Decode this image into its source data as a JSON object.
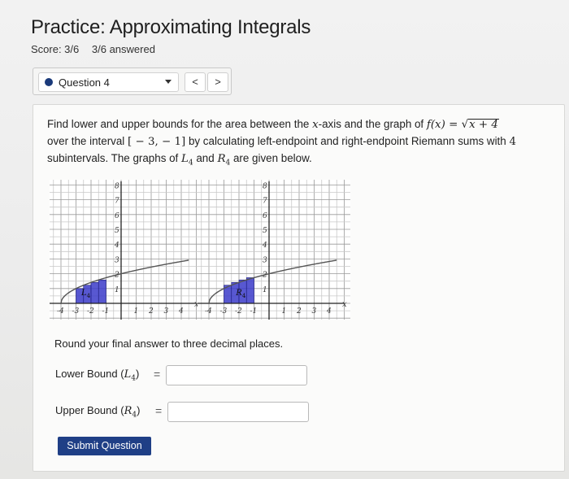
{
  "page": {
    "title": "Practice: Approximating Integrals",
    "score": "Score: 3/6",
    "answered": "3/6 answered"
  },
  "question_nav": {
    "label": "Question 4",
    "prev": "<",
    "next": ">"
  },
  "problem": {
    "part1": "Find lower and upper bounds for the area between the ",
    "x_var": "x",
    "part2": "-axis and the graph of ",
    "f_lhs": "f(x) = ",
    "sqrt_arg": "x + 4",
    "part3": "over the interval ",
    "interval": "[ − 3, − 1]",
    "part4": " by calculating left-endpoint and right-endpoint Riemann sums with ",
    "n": "4",
    "part5": "subintervals. The graphs of ",
    "L_sym": "L",
    "R_sym": "R",
    "sub": "4",
    "and": " and ",
    "part6": " are given below."
  },
  "graphs": {
    "left": {
      "badge": "L4",
      "badge_main": "L",
      "badge_sub": "4",
      "y_ticks": [
        "8",
        "7",
        "6",
        "5",
        "4",
        "3",
        "2",
        "1"
      ],
      "x_ticks": [
        "-4",
        "-3",
        "-2",
        "-1",
        "1",
        "2",
        "3",
        "4"
      ],
      "shade_color": "#3b3bc9"
    },
    "right": {
      "badge": "R4",
      "badge_main": "R",
      "badge_sub": "4",
      "y_ticks": [
        "8",
        "7",
        "6",
        "5",
        "4",
        "3",
        "2",
        "1"
      ],
      "x_ticks": [
        "-4",
        "-3",
        "-2",
        "-1",
        "1",
        "2",
        "3",
        "4"
      ],
      "shade_color": "#3b3bc9"
    },
    "axis_letter": "x"
  },
  "instructions": "Round your final answer to three decimal places.",
  "lower": {
    "label_text": "Lower Bound (",
    "sym": "L",
    "sub": "4",
    "close": ")",
    "eq": "=",
    "value": ""
  },
  "upper": {
    "label_text": "Upper Bound (",
    "sym": "R",
    "sub": "4",
    "close": ")",
    "eq": "=",
    "value": ""
  },
  "submit_label": "Submit Question",
  "colors": {
    "accent": "#1f3f86",
    "dot": "#1a3a7a",
    "shade": "#3b3bc9"
  }
}
